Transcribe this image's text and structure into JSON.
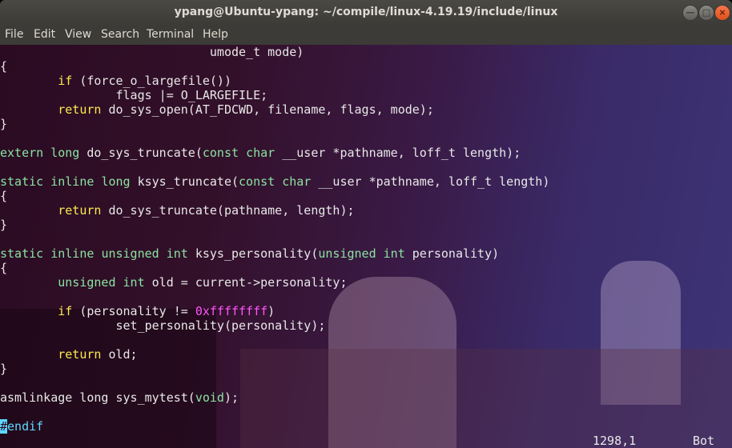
{
  "window": {
    "title": "ypang@Ubuntu-ypang: ~/compile/linux-4.19.19/include/linux",
    "buttons": {
      "minimize_icon": "minimize-icon",
      "maximize_icon": "maximize-icon",
      "close_icon": "close-icon"
    }
  },
  "menu": [
    "File",
    "Edit",
    "View",
    "Search",
    "Terminal",
    "Help"
  ],
  "colors": {
    "keyword": "#8ae2a0",
    "statement": "#fce94f",
    "number": "#ff55ff",
    "preproc": "#5fd7ff"
  },
  "editor": {
    "lines": [
      [
        [
          "                             umode_t mode)",
          ""
        ]
      ],
      [
        [
          "{",
          ""
        ]
      ],
      [
        [
          "        ",
          ""
        ],
        [
          "if",
          "st"
        ],
        [
          " (force_o_largefile())",
          ""
        ]
      ],
      [
        [
          "                flags |= O_LARGEFILE;",
          ""
        ]
      ],
      [
        [
          "        ",
          ""
        ],
        [
          "return",
          "st"
        ],
        [
          " do_sys_open(AT_FDCWD, filename, flags, mode);",
          ""
        ]
      ],
      [
        [
          "}",
          ""
        ]
      ],
      [],
      [
        [
          "extern",
          "kw"
        ],
        [
          " ",
          ""
        ],
        [
          "long",
          "kw"
        ],
        [
          " do_sys_truncate(",
          ""
        ],
        [
          "const",
          "kw"
        ],
        [
          " ",
          ""
        ],
        [
          "char",
          "kw"
        ],
        [
          " __user *pathname, loff_t length);",
          ""
        ]
      ],
      [],
      [
        [
          "static",
          "kw"
        ],
        [
          " ",
          ""
        ],
        [
          "inline",
          "kw"
        ],
        [
          " ",
          ""
        ],
        [
          "long",
          "kw"
        ],
        [
          " ksys_truncate(",
          ""
        ],
        [
          "const",
          "kw"
        ],
        [
          " ",
          ""
        ],
        [
          "char",
          "kw"
        ],
        [
          " __user *pathname, loff_t length)",
          ""
        ]
      ],
      [
        [
          "{",
          ""
        ]
      ],
      [
        [
          "        ",
          ""
        ],
        [
          "return",
          "st"
        ],
        [
          " do_sys_truncate(pathname, length);",
          ""
        ]
      ],
      [
        [
          "}",
          ""
        ]
      ],
      [],
      [
        [
          "static",
          "kw"
        ],
        [
          " ",
          ""
        ],
        [
          "inline",
          "kw"
        ],
        [
          " ",
          ""
        ],
        [
          "unsigned",
          "kw"
        ],
        [
          " ",
          ""
        ],
        [
          "int",
          "kw"
        ],
        [
          " ksys_personality(",
          ""
        ],
        [
          "unsigned",
          "kw"
        ],
        [
          " ",
          ""
        ],
        [
          "int",
          "kw"
        ],
        [
          " personality)",
          ""
        ]
      ],
      [
        [
          "{",
          ""
        ]
      ],
      [
        [
          "        ",
          ""
        ],
        [
          "unsigned",
          "kw"
        ],
        [
          " ",
          ""
        ],
        [
          "int",
          "kw"
        ],
        [
          " old = current->personality;",
          ""
        ]
      ],
      [],
      [
        [
          "        ",
          ""
        ],
        [
          "if",
          "st"
        ],
        [
          " (personality != ",
          ""
        ],
        [
          "0xffffffff",
          "num"
        ],
        [
          ")",
          ""
        ]
      ],
      [
        [
          "                set_personality(personality);",
          ""
        ]
      ],
      [],
      [
        [
          "        ",
          ""
        ],
        [
          "return",
          "st"
        ],
        [
          " old;",
          ""
        ]
      ],
      [
        [
          "}",
          ""
        ]
      ],
      [],
      [
        [
          "asmlinkage long sys_mytest(",
          ""
        ],
        [
          "void",
          "kw"
        ],
        [
          ");",
          ""
        ]
      ],
      [],
      [
        [
          "#",
          "cur"
        ],
        [
          "endif",
          "pp"
        ]
      ]
    ],
    "status_position": "1298,1",
    "status_scroll": "Bot"
  }
}
